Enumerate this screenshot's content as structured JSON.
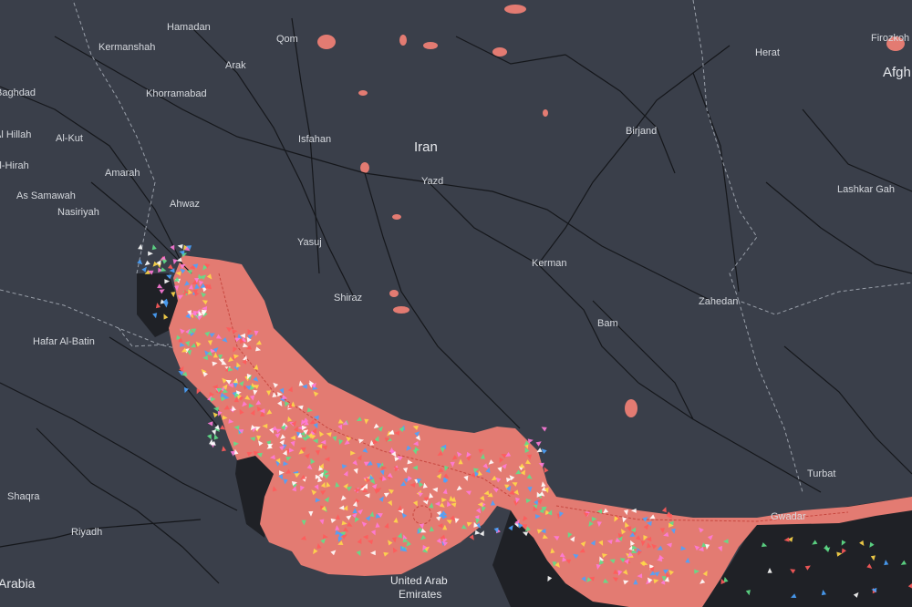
{
  "colors": {
    "land": "#3a3f4a",
    "water": "#1f2126",
    "coverage": "#e37b72",
    "roads": "#15171b",
    "border": "#9aa0aa",
    "vessel_colors": [
      "#ff7ad9",
      "#4aa3ff",
      "#5fe08a",
      "#ffd84a",
      "#ff5b5b",
      "#ffffff"
    ]
  },
  "labels": {
    "iran": "Iran",
    "afgh": "Afgh",
    "arabia": "Arabia",
    "uae": "United Arab\nEmirates",
    "uae_line1": "United Arab",
    "uae_line2": "Emirates",
    "cities": {
      "hamadan": "Hamadan",
      "kermanshah": "Kermanshah",
      "qom": "Qom",
      "arak": "Arak",
      "firozkoh": "Firozkoh",
      "herat": "Herat",
      "baghdad": "Baghdad",
      "khorramabad": "Khorramabad",
      "hillah": "Al Hillah",
      "alkut": "Al-Kut",
      "isfahan": "Isfahan",
      "birjand": "Birjand",
      "hirah": "Al-Hirah",
      "amarah": "Amarah",
      "yazd": "Yazd",
      "samawah": "As Samawah",
      "ahwaz": "Ahwaz",
      "lashkargah": "Lashkar Gah",
      "nasiriyah": "Nasiriyah",
      "yasuj": "Yasuj",
      "kerman": "Kerman",
      "shiraz": "Shiraz",
      "zahedan": "Zahedan",
      "hafar": "Hafar Al-Batin",
      "bam": "Bam",
      "turbat": "Turbat",
      "shaqra": "Shaqra",
      "gwadar": "Gwadar",
      "riyadh": "Riyadh"
    }
  },
  "icons": {
    "vessel": "triangle-icon"
  }
}
